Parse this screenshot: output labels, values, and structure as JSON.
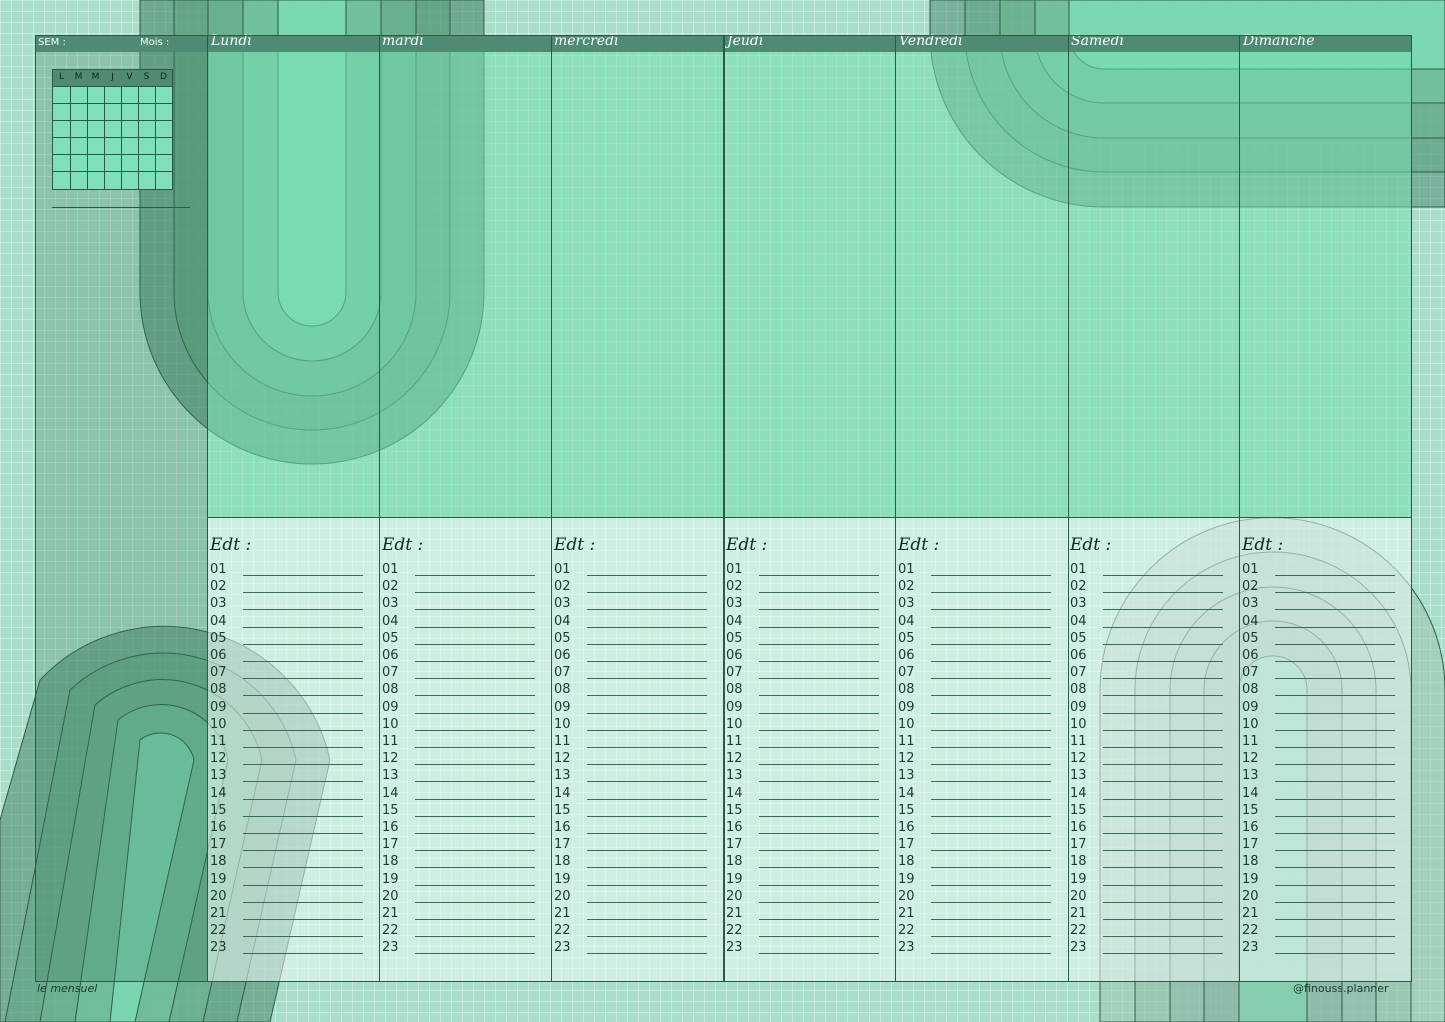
{
  "header": {
    "sem_label": "SEM :",
    "mois_label": "Mois :"
  },
  "days": [
    "Lundi",
    "mardi",
    "mercredi",
    "Jeudi",
    "Vendredi",
    "Samedi",
    "Dimanche"
  ],
  "mini_calendar": {
    "letters": [
      "L",
      "M",
      "M",
      "J",
      "V",
      "S",
      "D"
    ]
  },
  "edt_label": "Edt :",
  "hours": [
    "01",
    "02",
    "03",
    "04",
    "05",
    "06",
    "07",
    "08",
    "09",
    "10",
    "11",
    "12",
    "13",
    "14",
    "15",
    "16",
    "17",
    "18",
    "19",
    "20",
    "21",
    "22",
    "23"
  ],
  "footer": {
    "left": "le mensuel",
    "right": "@finouss.planner"
  },
  "colors": {
    "header_bar": "#4f8b72",
    "background": "#a9dfc8",
    "notes_area": "#76dcb0",
    "edt_area": "#ecfaf4"
  }
}
